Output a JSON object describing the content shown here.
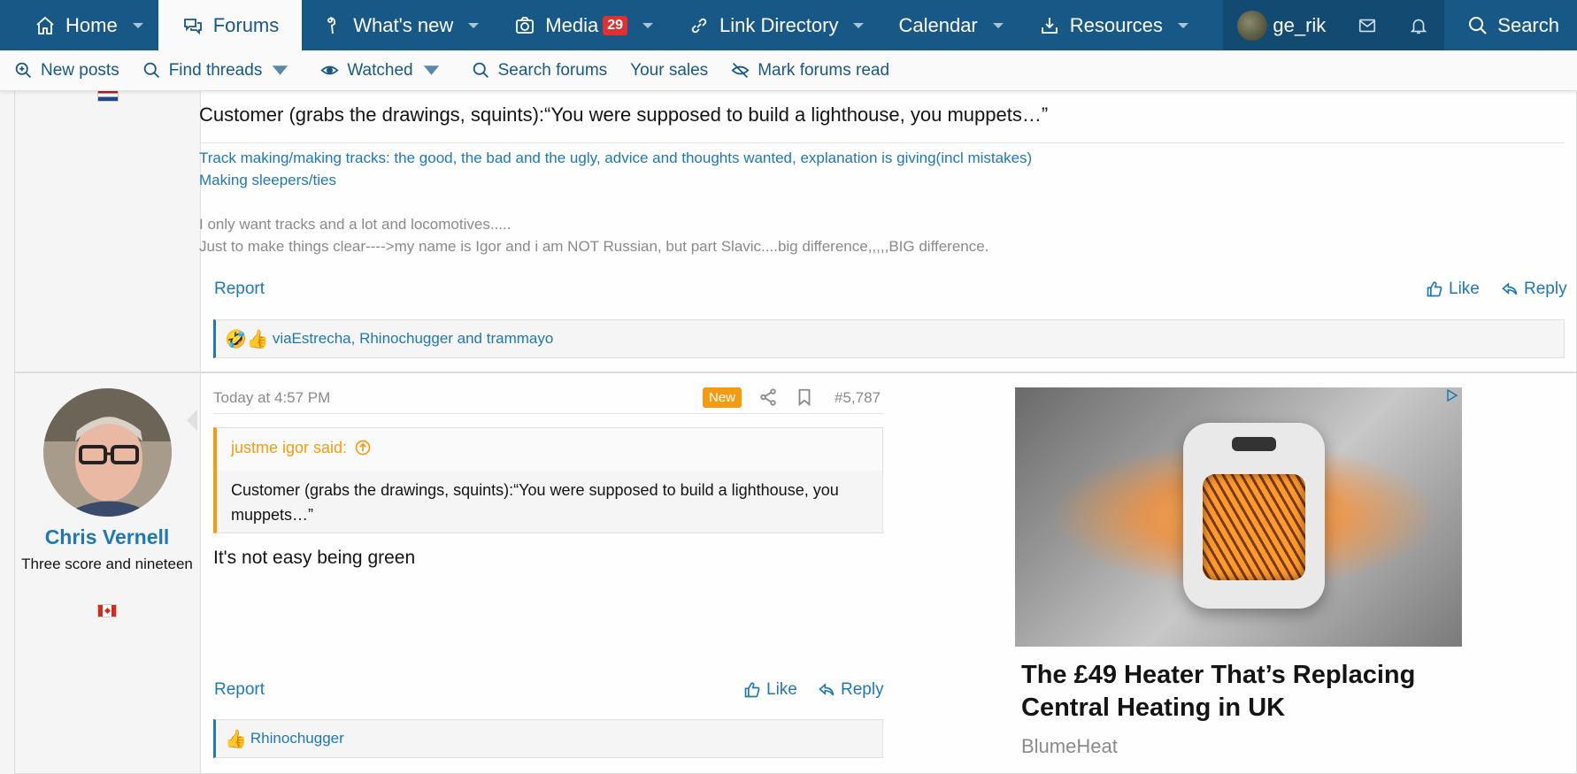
{
  "topnav": {
    "tabs": [
      {
        "label": "Home",
        "icon": "home-icon"
      },
      {
        "label": "Forums",
        "icon": "forums-icon",
        "active": true
      },
      {
        "label": "What's new",
        "icon": "whats-new-icon"
      },
      {
        "label": "Media",
        "icon": "camera-icon",
        "badge": "29"
      },
      {
        "label": "Link Directory",
        "icon": "link-icon"
      },
      {
        "label": "Calendar"
      },
      {
        "label": "Resources",
        "icon": "download-icon"
      }
    ],
    "username": "ge_rik",
    "search_label": "Search"
  },
  "subnav": {
    "items": [
      {
        "label": "New posts",
        "icon": "new-posts-icon"
      },
      {
        "label": "Find threads",
        "icon": "search-icon",
        "caret": true
      },
      {
        "label": "Watched",
        "icon": "eye-icon",
        "caret": true
      },
      {
        "label": "Search forums",
        "icon": "search-icon"
      },
      {
        "label": "Your sales"
      },
      {
        "label": "Mark forums read",
        "icon": "eye-off-icon"
      }
    ]
  },
  "post1": {
    "quote_line": "Customer (grabs the drawings, squints):“You were supposed to build a lighthouse, you muppets…”",
    "signature_links": [
      "Track making/making tracks: the good, the bad and the ugly, advice and thoughts wanted, explanation is giving(incl mistakes)",
      "Making sleepers/ties"
    ],
    "signature_text": [
      "I only want tracks and a lot and locomotives.....",
      "Just to make things clear---->my name is Igor and i am NOT Russian, but part Slavic....big difference,,,,,BIG difference."
    ],
    "report_label": "Report",
    "like_label": "Like",
    "reply_label": "Reply",
    "reactions_emoji": "🤣👍",
    "reactions_text": "viaEstrecha, Rhinochugger and trammayo"
  },
  "post2": {
    "username": "Chris Vernell",
    "user_title": "Three score and nineteen",
    "date": "Today at 4:57 PM",
    "new_badge": "New",
    "post_number": "#5,787",
    "quote_author": "justme igor said:",
    "quote_text": "Customer (grabs the drawings, squints):“You were supposed to build a lighthouse, you muppets…”",
    "message": "It's not easy being green",
    "report_label": "Report",
    "like_label": "Like",
    "reply_label": "Reply",
    "reactions_emoji": "👍",
    "reactions_text": "Rhinochugger"
  },
  "ad": {
    "title": "The £49 Heater That’s Replacing Central Heating in UK",
    "brand": "BlumeHeat"
  },
  "colors": {
    "nav_bg": "#185886",
    "link": "#1f78b4",
    "accent_orange": "#f39c12",
    "badge_red": "#e03030"
  }
}
